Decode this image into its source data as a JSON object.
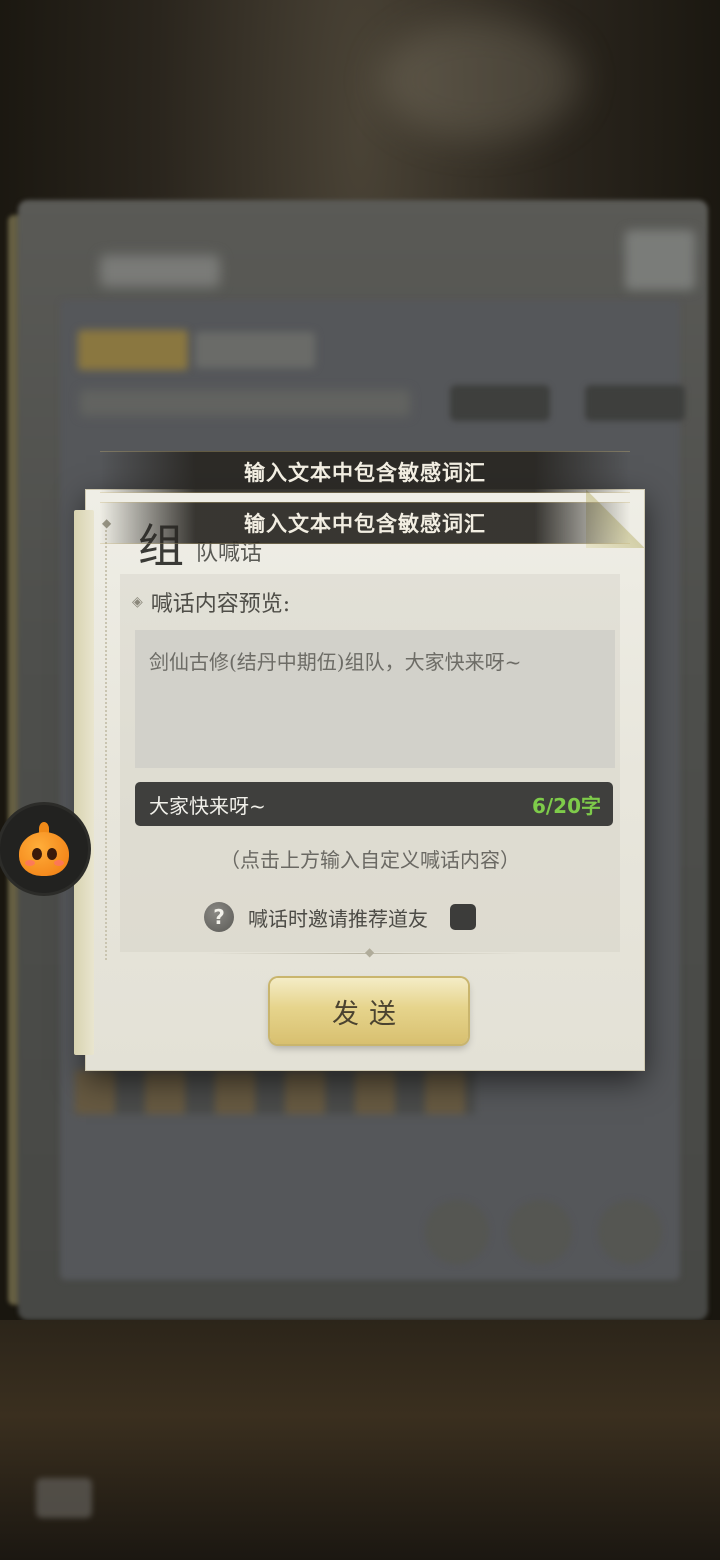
{
  "toasts": [
    "输入文本中包含敏感词汇",
    "输入文本中包含敏感词汇"
  ],
  "dialog": {
    "title_big": "组",
    "title_small": "队喊话",
    "preview_label": "喊话内容预览:",
    "preview_text": "剑仙古修(结丹中期伍)组队，大家快来呀~",
    "input_value": "大家快来呀~",
    "char_count": "6/20字",
    "hint": "（点击上方输入自定义喊话内容）",
    "help_symbol": "?",
    "invite_label": "喊话时邀请推荐道友",
    "invite_checked": false,
    "send_label": "发送"
  },
  "colors": {
    "char_count": "#7ecb4a",
    "send_button": "#e6d48c",
    "mascot": "#f07a10"
  },
  "icons": [
    "question-mark-icon",
    "mascot-assistant-icon",
    "diamond-bullet-icon"
  ]
}
